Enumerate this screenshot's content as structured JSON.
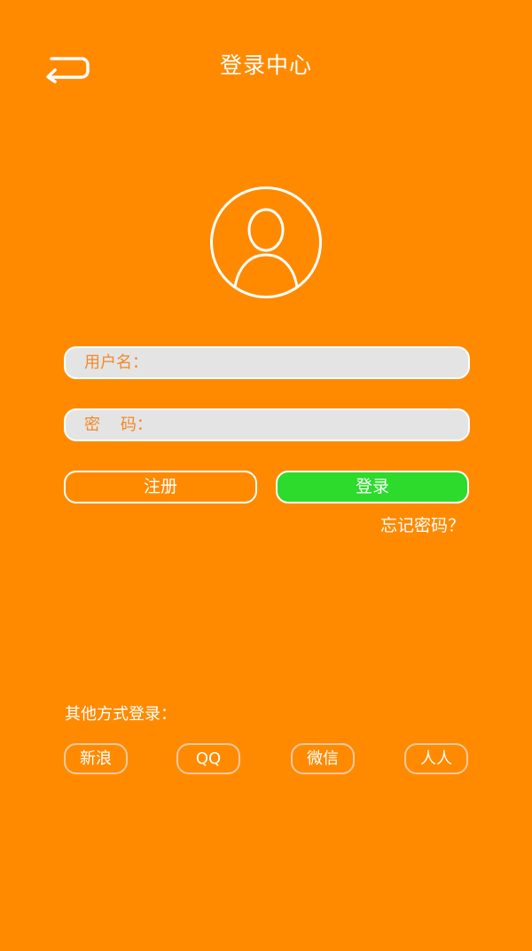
{
  "header": {
    "title": "登录中心",
    "back_icon": "back-arrow-icon"
  },
  "avatar": {
    "icon": "user-avatar-icon"
  },
  "form": {
    "username_label": "用户名：",
    "username_value": "",
    "password_label": "密    码：",
    "password_value": ""
  },
  "buttons": {
    "register_label": "注册",
    "login_label": "登录"
  },
  "forgot_password": "忘记密码？",
  "other_login": {
    "title": "其他方式登录：",
    "options": [
      "新浪",
      "QQ",
      "微信",
      "人人"
    ]
  },
  "colors": {
    "background": "#ff8a00",
    "login_button": "#2cdb2c",
    "field_background": "#e4e4e4",
    "label_text": "#f08a2a"
  }
}
